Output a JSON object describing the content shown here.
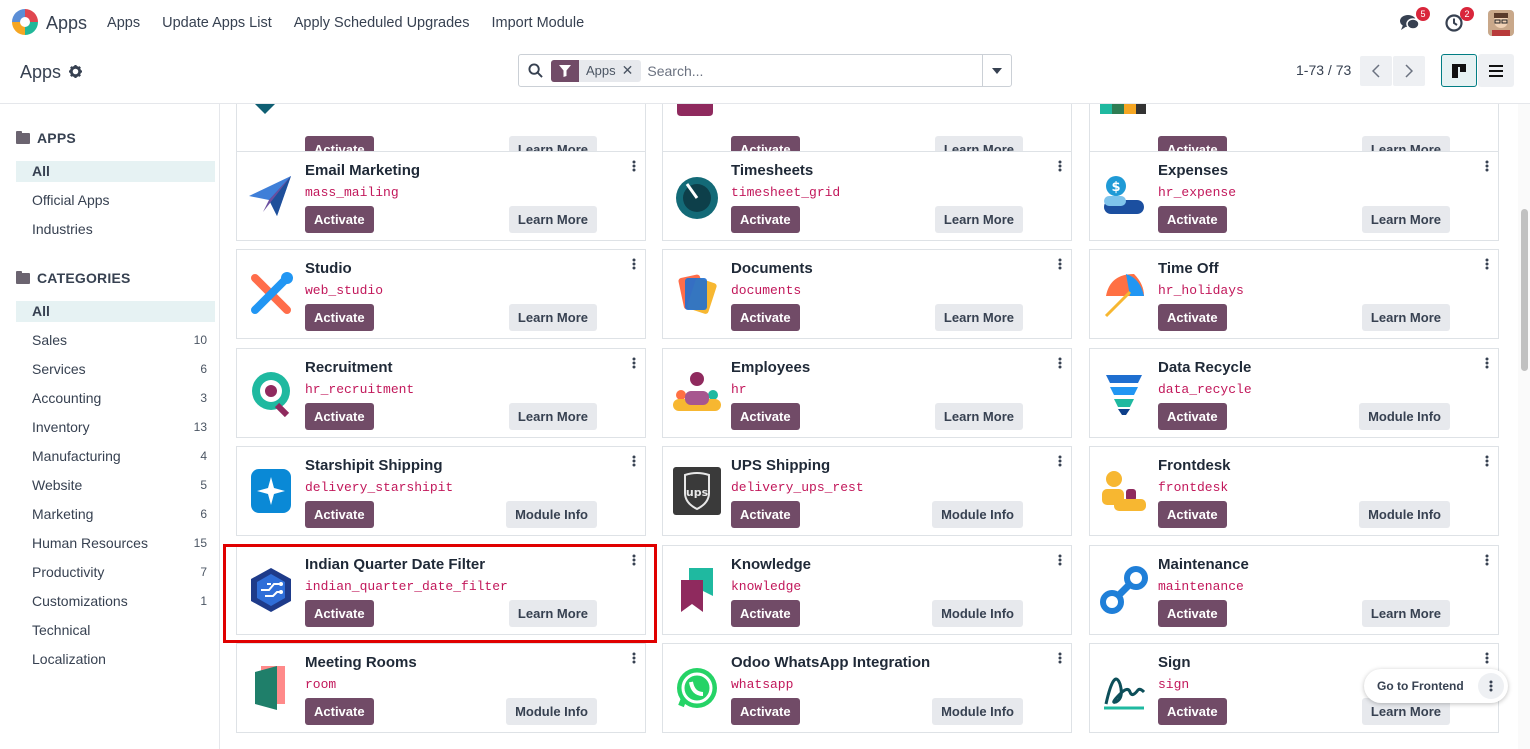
{
  "nav": {
    "app_title": "Apps",
    "menu": [
      "Apps",
      "Update Apps List",
      "Apply Scheduled Upgrades",
      "Import Module"
    ],
    "messages_badge": "5",
    "activity_badge": "2"
  },
  "control": {
    "breadcrumb": "Apps",
    "facet_label": "Apps",
    "search_placeholder": "Search...",
    "pager": "1-73 / 73"
  },
  "sidebar": {
    "apps_header": "APPS",
    "apps_items": [
      "All",
      "Official Apps",
      "Industries"
    ],
    "categories_header": "CATEGORIES",
    "categories": [
      {
        "label": "All",
        "count": ""
      },
      {
        "label": "Sales",
        "count": "10"
      },
      {
        "label": "Services",
        "count": "6"
      },
      {
        "label": "Accounting",
        "count": "3"
      },
      {
        "label": "Inventory",
        "count": "13"
      },
      {
        "label": "Manufacturing",
        "count": "4"
      },
      {
        "label": "Website",
        "count": "5"
      },
      {
        "label": "Marketing",
        "count": "6"
      },
      {
        "label": "Human Resources",
        "count": "15"
      },
      {
        "label": "Productivity",
        "count": "7"
      },
      {
        "label": "Customizations",
        "count": "1"
      },
      {
        "label": "Technical",
        "count": ""
      },
      {
        "label": "Localization",
        "count": ""
      }
    ]
  },
  "cards": [
    {
      "name": "",
      "tech": "",
      "primary": "Activate",
      "secondary": "Learn More",
      "icon": "partial-teal-icon"
    },
    {
      "name": "",
      "tech": "",
      "primary": "Activate",
      "secondary": "Learn More",
      "icon": "partial-purple-icon"
    },
    {
      "name": "",
      "tech": "",
      "primary": "Activate",
      "secondary": "Learn More",
      "icon": "partial-multicolor-icon"
    },
    {
      "name": "Email Marketing",
      "tech": "mass_mailing",
      "primary": "Activate",
      "secondary": "Learn More",
      "icon": "paper-plane-icon"
    },
    {
      "name": "Timesheets",
      "tech": "timesheet_grid",
      "primary": "Activate",
      "secondary": "Learn More",
      "icon": "stopwatch-icon"
    },
    {
      "name": "Expenses",
      "tech": "hr_expense",
      "primary": "Activate",
      "secondary": "Learn More",
      "icon": "money-icon"
    },
    {
      "name": "Studio",
      "tech": "web_studio",
      "primary": "Activate",
      "secondary": "Learn More",
      "icon": "tools-icon"
    },
    {
      "name": "Documents",
      "tech": "documents",
      "primary": "Activate",
      "secondary": "Learn More",
      "icon": "documents-icon"
    },
    {
      "name": "Time Off",
      "tech": "hr_holidays",
      "primary": "Activate",
      "secondary": "Learn More",
      "icon": "umbrella-icon"
    },
    {
      "name": "Recruitment",
      "tech": "hr_recruitment",
      "primary": "Activate",
      "secondary": "Learn More",
      "icon": "magnifier-person-icon"
    },
    {
      "name": "Employees",
      "tech": "hr",
      "primary": "Activate",
      "secondary": "Learn More",
      "icon": "people-icon"
    },
    {
      "name": "Data Recycle",
      "tech": "data_recycle",
      "primary": "Activate",
      "secondary": "Module Info",
      "icon": "recycle-icon"
    },
    {
      "name": "Starshipit Shipping",
      "tech": "delivery_starshipit",
      "primary": "Activate",
      "secondary": "Module Info",
      "icon": "starshipit-icon"
    },
    {
      "name": "UPS Shipping",
      "tech": "delivery_ups_rest",
      "primary": "Activate",
      "secondary": "Module Info",
      "icon": "ups-icon"
    },
    {
      "name": "Frontdesk",
      "tech": "frontdesk",
      "primary": "Activate",
      "secondary": "Module Info",
      "icon": "frontdesk-icon"
    },
    {
      "name": "Indian Quarter Date Filter",
      "tech": "indian_quarter_date_filter",
      "primary": "Activate",
      "secondary": "Learn More",
      "icon": "circuit-hexagon-icon"
    },
    {
      "name": "Knowledge",
      "tech": "knowledge",
      "primary": "Activate",
      "secondary": "Module Info",
      "icon": "bookmark-icon"
    },
    {
      "name": "Maintenance",
      "tech": "maintenance",
      "primary": "Activate",
      "secondary": "Learn More",
      "icon": "chain-link-icon"
    },
    {
      "name": "Meeting Rooms",
      "tech": "room",
      "primary": "Activate",
      "secondary": "Module Info",
      "icon": "door-icon"
    },
    {
      "name": "Odoo WhatsApp Integration",
      "tech": "whatsapp",
      "primary": "Activate",
      "secondary": "Module Info",
      "icon": "whatsapp-icon"
    },
    {
      "name": "Sign",
      "tech": "sign",
      "primary": "Activate",
      "secondary": "Learn More",
      "icon": "signature-icon"
    }
  ],
  "frontend_button": "Go to Frontend",
  "colors": {
    "primary": "#714b67",
    "accent": "#017e84",
    "highlight": "#e00000",
    "technical_name": "#c2185b"
  }
}
